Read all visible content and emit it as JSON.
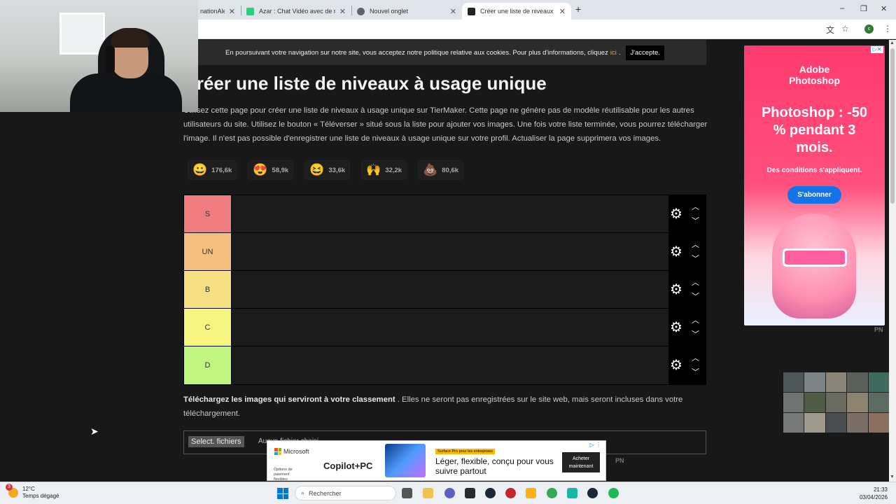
{
  "browser": {
    "tabs": [
      {
        "title": "nationAle",
        "icon_color": "#1a73e8",
        "active": false
      },
      {
        "title": "Azar : Chat Vidéo avec de nouv",
        "icon_color": "#26d07c",
        "active": false
      },
      {
        "title": "Nouvel onglet",
        "icon_color": "#5f6368",
        "active": false
      },
      {
        "title": "Créer une liste de niveaux à usa",
        "icon_color": "#222222",
        "active": true
      }
    ],
    "new_tab": "+",
    "window_controls": {
      "minimize": "–",
      "maximize": "❐",
      "close": "✕"
    },
    "toolbar_icons": {
      "translate": "translate-icon",
      "bookmark": "star-icon",
      "menu": "kebab-menu-icon"
    },
    "profile_initial": "c"
  },
  "cookie_bar": {
    "text": "En poursuivant votre navigation sur notre site, vous acceptez notre politique relative aux cookies. Pour plus d'informations, cliquez",
    "link": "ici",
    "period": ".",
    "accept": "J'accepte."
  },
  "page": {
    "title": "Créer une liste de niveaux à usage unique",
    "intro": "Utilisez cette page pour créer une liste de niveaux à usage unique sur TierMaker. Cette page ne génère pas de modèle réutilisable pour les autres utilisateurs du site. Utilisez le bouton « Téléverser » situé sous la liste pour ajouter vos images. Une fois votre liste terminée, vous pourrez télécharger l'image. Il n'est pas possible d'enregistrer une liste de niveaux à usage unique sur votre profil. Actualiser la page supprimera vos images.",
    "reactions": [
      {
        "emoji": "😀",
        "count": "176,6k"
      },
      {
        "emoji": "😍",
        "count": "58,9k"
      },
      {
        "emoji": "😆",
        "count": "33,6k"
      },
      {
        "emoji": "🙌",
        "count": "32,2k"
      },
      {
        "emoji": "💩",
        "count": "80,6k"
      }
    ],
    "tiers": [
      {
        "label": "S",
        "color": "#f07c80"
      },
      {
        "label": "UN",
        "color": "#f5bf7f"
      },
      {
        "label": "B",
        "color": "#f5df80"
      },
      {
        "label": "C",
        "color": "#f6f57f"
      },
      {
        "label": "D",
        "color": "#c0f57f"
      }
    ],
    "upload_bold": "Téléchargez les images qui serviront à votre classement",
    "upload_rest": " . Elles ne seront pas enregistrées sur le site web, mais seront incluses dans votre téléchargement.",
    "file_button": "Select. fichiers",
    "file_status": "Aucun fichier choisi"
  },
  "ad_right": {
    "brand": "Adobe Photoshop",
    "offer": "Photoshop : -50 % pendant 3 mois.",
    "conditions": "Des conditions s'appliquent.",
    "cta": "S'abonner",
    "pn": "PN"
  },
  "ad_bottom": {
    "brand": "Microsoft",
    "sub": "Options de paiement flexibles",
    "product": "Copilot+PC",
    "badge": "Surface Pro pour les entreprises",
    "tagline": "Léger, flexible, conçu pour vous suivre partout",
    "cta": "Acheter maintenant",
    "pn": "PN"
  },
  "taskbar": {
    "temperature": "12°C",
    "weather": "Temps dégagé",
    "weather_badge": "3",
    "search_placeholder": "Rechercher",
    "time": "21:33",
    "date": "03/04/2026",
    "apps": [
      {
        "name": "file-explorer-icon",
        "color": "#f2c14e"
      },
      {
        "name": "task-view-icon",
        "color": "#555555"
      },
      {
        "name": "chat-icon",
        "color": "#5b5fc7"
      },
      {
        "name": "epic-games-icon",
        "color": "#2a2a2a"
      },
      {
        "name": "steam-icon",
        "color": "#1b2838"
      },
      {
        "name": "app-red-icon",
        "color": "#c4262e"
      },
      {
        "name": "rockstar-icon",
        "color": "#fcaf17"
      },
      {
        "name": "chrome-icon",
        "color": "#34a853"
      },
      {
        "name": "app-teal-icon",
        "color": "#16b7a8"
      },
      {
        "name": "steam-2-icon",
        "color": "#1b2838"
      },
      {
        "name": "spotify-icon",
        "color": "#1db954"
      }
    ]
  }
}
